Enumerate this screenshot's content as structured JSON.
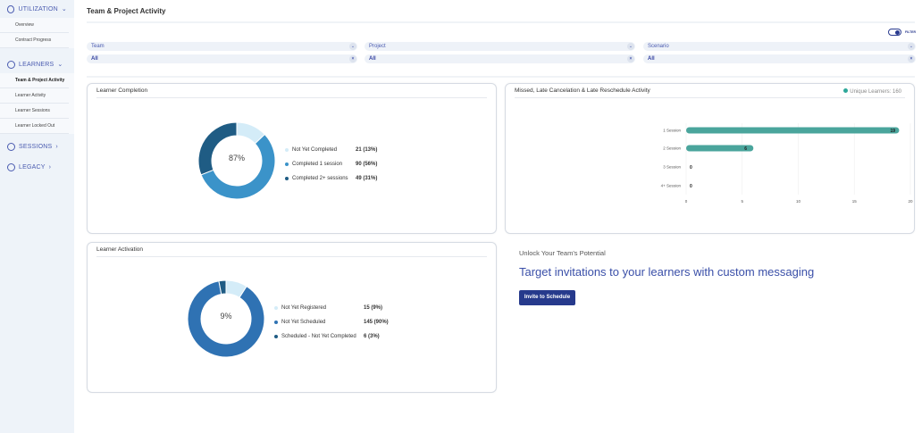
{
  "sidebar": {
    "sections": [
      {
        "label": "UTILIZATION",
        "items": [
          "Overview",
          "Contract Progress"
        ]
      },
      {
        "label": "LEARNERS",
        "items": [
          "Team & Project Activity",
          "Learner Activity",
          "Learner Sessions",
          "Learner Locked Out"
        ]
      },
      {
        "label": "SESSIONS"
      },
      {
        "label": "LEGACY"
      }
    ],
    "active": "Team & Project Activity"
  },
  "header": {
    "title": "Team & Project Activity",
    "filter_label": "FILTER",
    "filter_on": true
  },
  "filters": [
    {
      "label": "Team",
      "value": "All"
    },
    {
      "label": "Project",
      "value": "All"
    },
    {
      "label": "Scenario",
      "value": "All"
    }
  ],
  "completion": {
    "title": "Learner Completion",
    "center": "87%",
    "legend": [
      {
        "label": "Not Yet Completed",
        "value": "21 (13%)",
        "pct": 13,
        "color": "#d4ecf8"
      },
      {
        "label": "Completed 1 session",
        "value": "90 (56%)",
        "pct": 56,
        "color": "#3b93c9"
      },
      {
        "label": "Completed 2+ sessions",
        "value": "49 (31%)",
        "pct": 31,
        "color": "#1f5c84"
      }
    ]
  },
  "activation": {
    "title": "Learner Activation",
    "center": "9%",
    "legend": [
      {
        "label": "Not Yet Registered",
        "value": "15 (9%)",
        "pct": 9,
        "color": "#d4ecf8"
      },
      {
        "label": "Not Yet Scheduled",
        "value": "145 (90%)",
        "pct": 88,
        "color": "#2f72b3"
      },
      {
        "label": "Scheduled - Not Yet Completed",
        "value": "6 (3%)",
        "pct": 3,
        "color": "#1f5c84"
      }
    ]
  },
  "chart_data": {
    "type": "bar",
    "orientation": "horizontal",
    "title": "Missed, Late Cancelation & Late Reschedule Activity",
    "legend": "Unique Learners: 160",
    "legend_position": "top-right",
    "categories": [
      "1 Session",
      "2 Session",
      "3 Session",
      "4+ Session"
    ],
    "values": [
      19,
      6,
      0,
      0
    ],
    "xlim": [
      0,
      20
    ],
    "xticks": [
      0,
      5,
      10,
      15,
      20
    ],
    "grid": true,
    "color": "#4aa59c"
  },
  "promo": {
    "subtitle": "Unlock Your Team's Potential",
    "headline": "Target invitations to your learners with custom messaging",
    "button": "Invite to Schedule"
  }
}
